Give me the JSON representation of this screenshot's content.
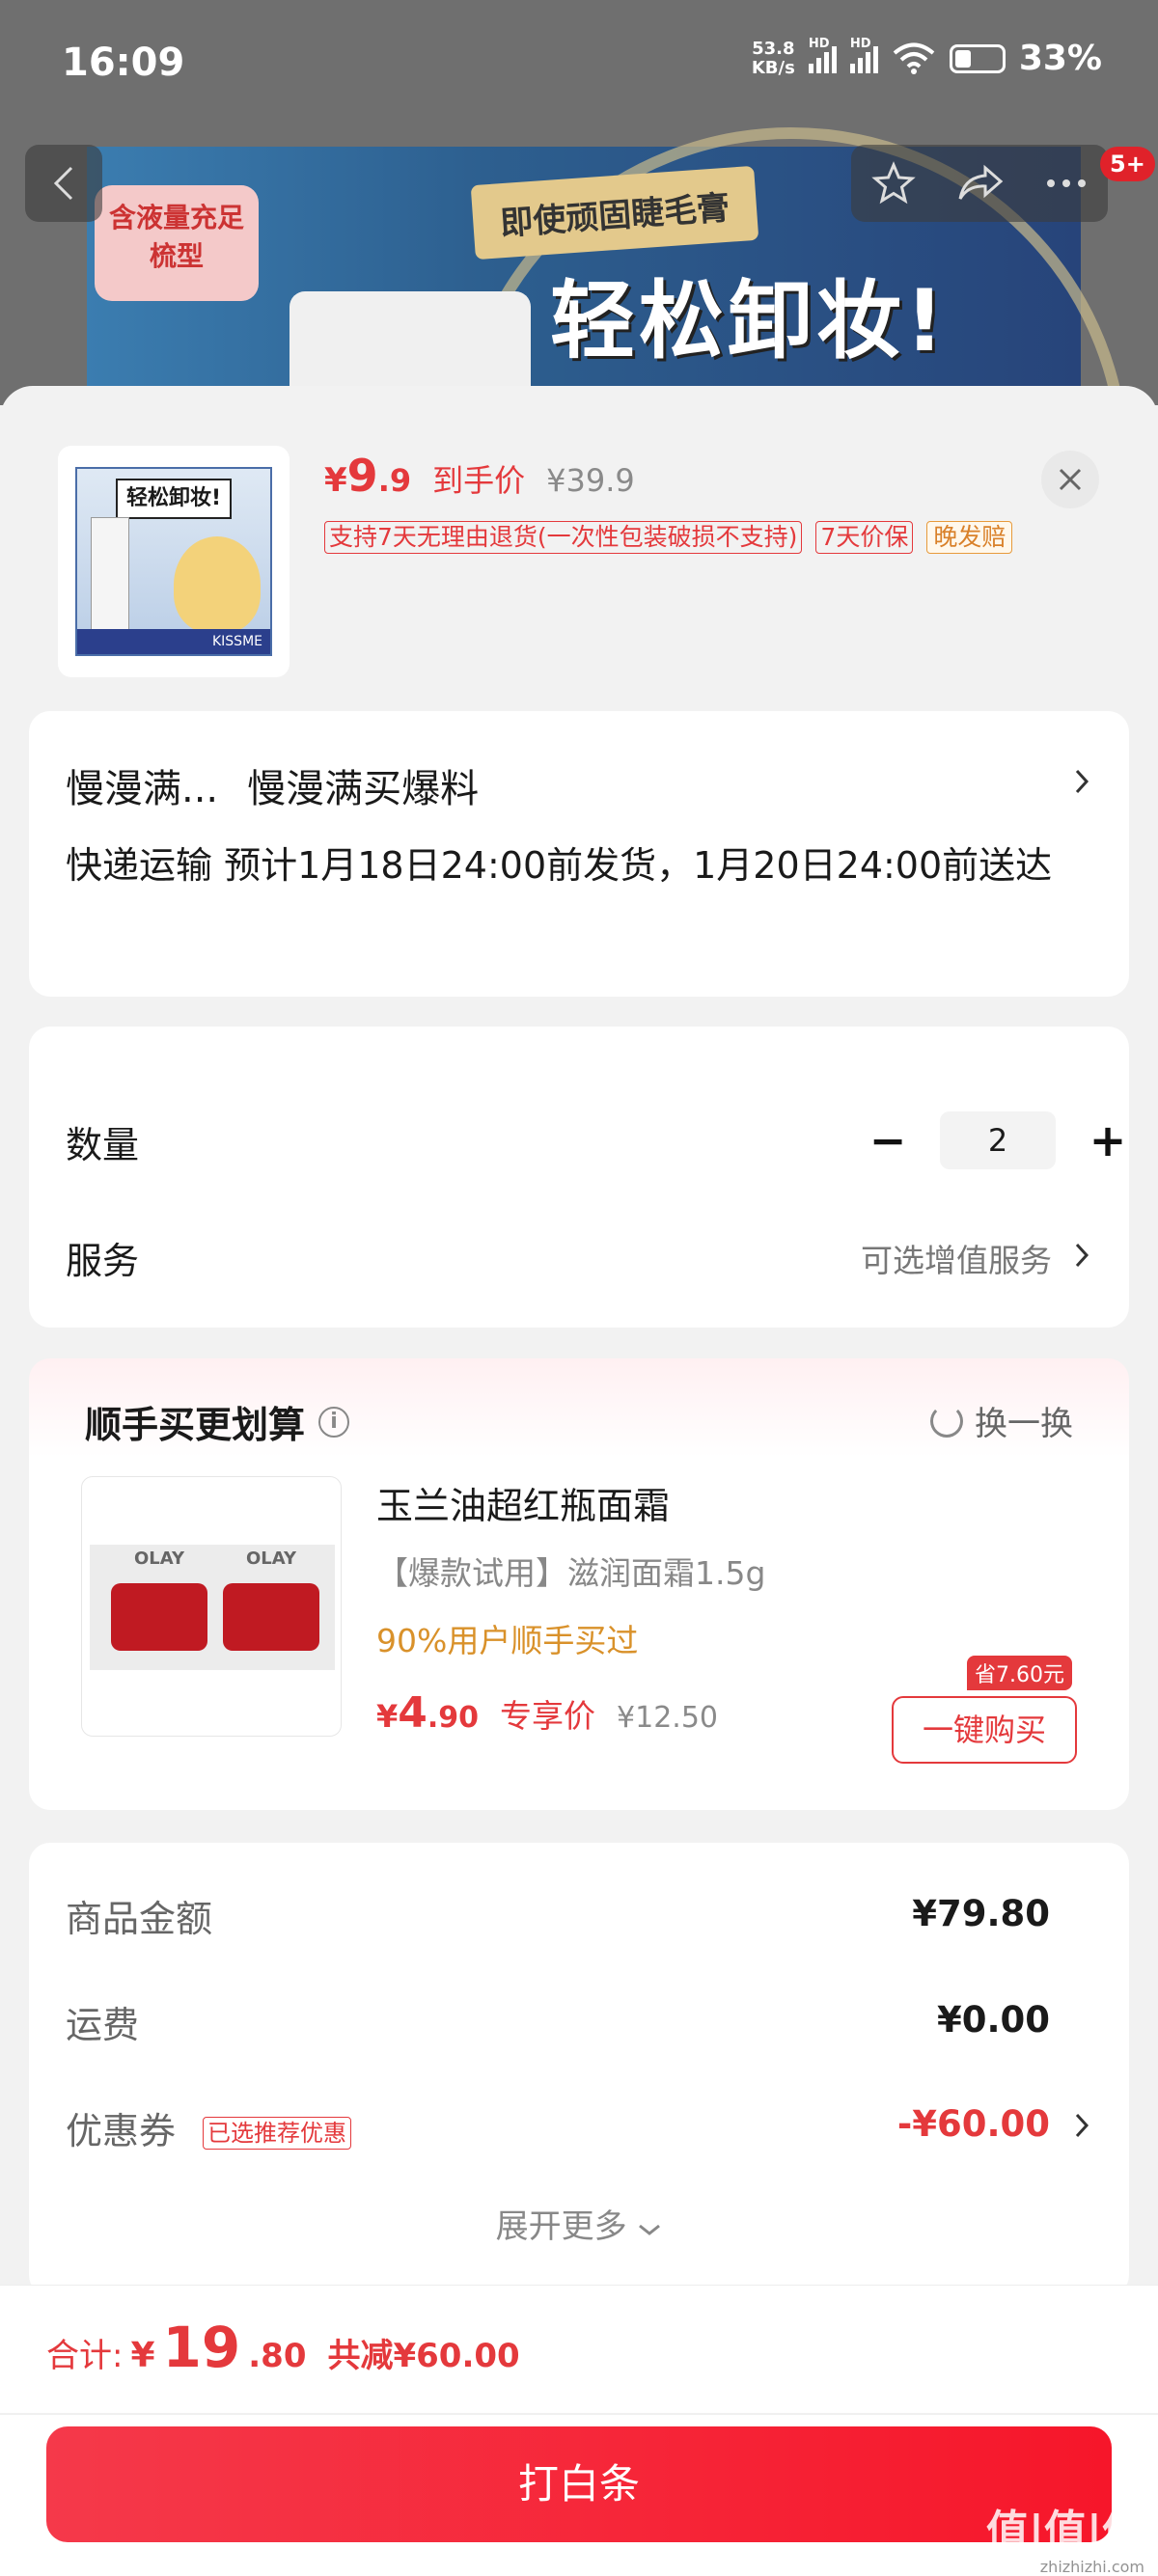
{
  "status_bar": {
    "time": "16:09",
    "net_speed_top": "53.8",
    "net_speed_unit": "KB/s",
    "hd1": "HD",
    "hd2": "HD",
    "battery": "33%"
  },
  "banner": {
    "tag_line1": "含液量充足",
    "tag_line2": "梳型",
    "gold_text": "即使顽固睫毛膏",
    "big_text": "轻松卸妆!",
    "notification_count": "5+"
  },
  "product": {
    "price_symbol": "¥",
    "price_int": "9",
    "price_dec": ".9",
    "price_label": "到手价",
    "original_price": "¥39.9",
    "tag_return": "支持7天无理由退货(一次性包装破损不支持)",
    "tag_price_protect": "7天价保",
    "tag_late": "晚发赔",
    "image_box_title": "轻松卸妆!",
    "image_brand": "KISSME"
  },
  "delivery": {
    "line1_a": "慢漫满...",
    "line1_b": "慢漫满买爆料",
    "line2": "快递运输 预计1月18日24:00前发货，1月20日24:00前送达"
  },
  "quantity": {
    "label": "数量",
    "minus": "−",
    "value": "2",
    "plus": "+"
  },
  "service": {
    "label": "服务",
    "hint": "可选增值服务"
  },
  "recommend": {
    "title": "顺手买更划算",
    "info": "i",
    "swap_label": "换一换",
    "item_name": "玉兰油超红瓶面霜",
    "item_spec": "【爆款试用】滋润面霜1.5g",
    "item_bought": "90%用户顺手买过",
    "price_symbol": "¥",
    "price_int": "4",
    "price_dec": ".90",
    "price_label": "专享价",
    "old_price": "¥12.50",
    "save_tag": "省7.60元",
    "buy_label": "一键购买"
  },
  "summary": {
    "goods_label": "商品金额",
    "goods_value": "¥79.80",
    "shipping_label": "运费",
    "shipping_value": "¥0.00",
    "coupon_label": "优惠券",
    "coupon_tag": "已选推荐优惠",
    "coupon_value": "-¥60.00",
    "expand_label": "展开更多"
  },
  "footer": {
    "total_label": "合计:",
    "total_symbol": "¥",
    "total_int": "19",
    "total_dec": ".80",
    "total_save": "共减¥60.00",
    "pay_label": "打白条",
    "watermark": "值|值|值",
    "watermark_url": "zhizhizhi.com"
  },
  "colors": {
    "accent": "#e4393c",
    "orange": "#d9912a",
    "pay_button": "#f6162a"
  }
}
